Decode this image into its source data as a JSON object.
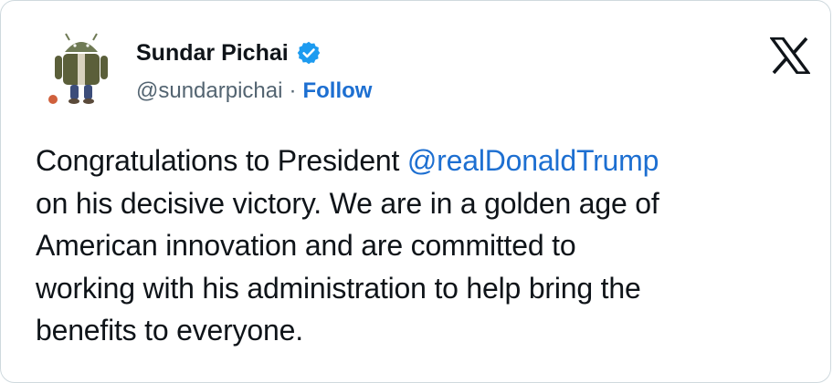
{
  "author": {
    "display_name": "Sundar Pichai",
    "handle": "@sundarpichai",
    "separator": "·",
    "follow_label": "Follow",
    "avatar_icon": "android-figure-avatar",
    "verified_icon": "verified-badge-icon"
  },
  "brand": {
    "logo_icon": "x-logo-icon"
  },
  "tweet": {
    "line1_text": "Congratulations to President ",
    "mention": "@realDonaldTrump",
    "line2": "on his decisive victory. We are in a golden age of",
    "line3": "American innovation and are committed to",
    "line4": "working with his administration to help bring the",
    "line5": "benefits to everyone."
  },
  "colors": {
    "text": "#0f1419",
    "secondary": "#536471",
    "link": "#1d6fd1",
    "verified": "#1d9bf0",
    "border": "#cfd9de"
  }
}
